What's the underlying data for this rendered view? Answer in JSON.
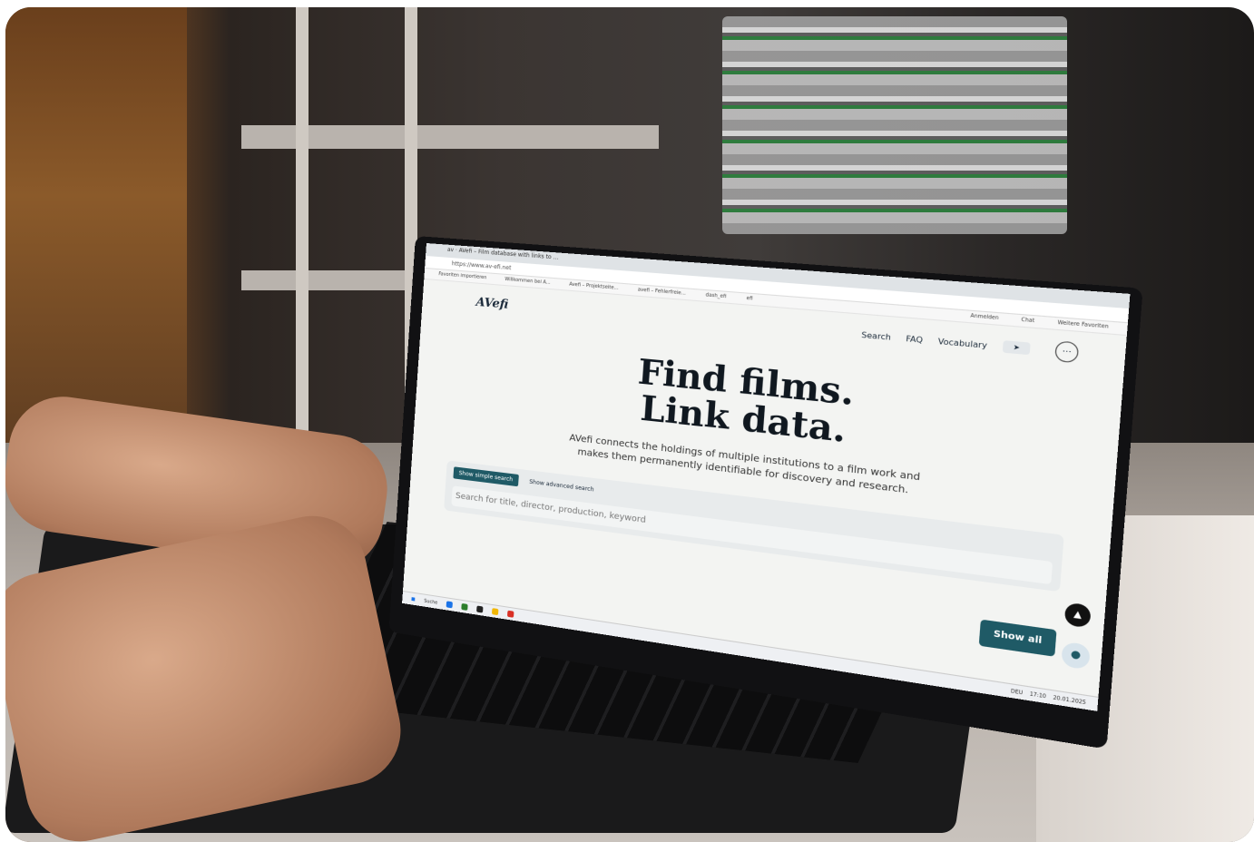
{
  "browser": {
    "tab_title": "av · AVefi – Film database with links to ...",
    "url": "https://www.av-efi.net",
    "bookmarks": [
      "Favoriten importieren",
      "Willkommen bei A...",
      "Avefi – Projektseite...",
      "avefi – Fehlerfreie...",
      "dash_efi",
      "efi"
    ],
    "profile_label": "Anmelden",
    "chat_label": "Chat",
    "other_favorites": "Weitere Favoriten"
  },
  "site": {
    "logo": "AVefi",
    "nav": [
      "Search",
      "FAQ",
      "Vocabulary"
    ],
    "send_icon": "paper-plane-icon",
    "more_icon": "ellipsis-icon"
  },
  "hero": {
    "title_line1": "Find films.",
    "title_line2": "Link data.",
    "subtitle": "AVefi connects the holdings of multiple institutions to a film work and makes them permanently identifiable for discovery and research."
  },
  "search": {
    "simple_toggle": "Show simple search",
    "advanced_toggle": "Show advanced search",
    "placeholder": "Search for title, director, production, keyword",
    "show_all": "Show all"
  },
  "taskbar": {
    "search_label": "Suche",
    "language": "DEU",
    "time": "17:10",
    "date": "20.01.2025"
  },
  "colors": {
    "accent": "#1f5a66",
    "page_bg": "#f3f4f2",
    "heading": "#101820"
  }
}
